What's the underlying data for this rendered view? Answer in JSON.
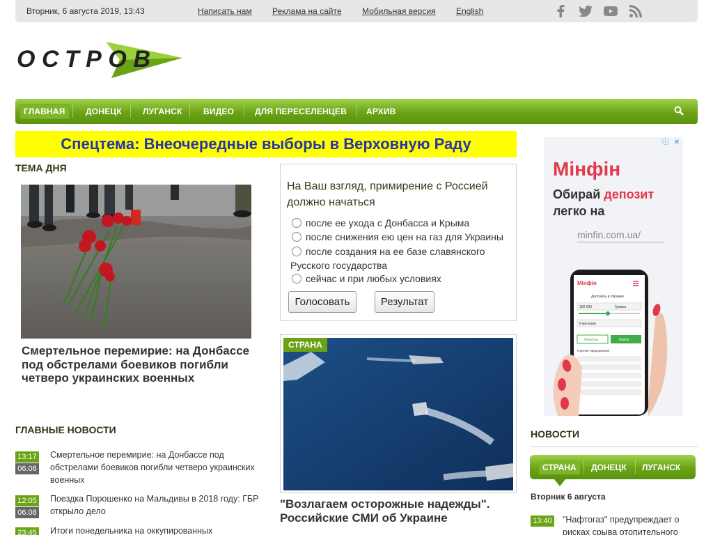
{
  "topbar": {
    "date": "Вторник, 6 августа 2019, 13:43",
    "links": [
      "Написать нам",
      "Реклама на сайте",
      "Мобильная версия",
      "English"
    ],
    "social_icons": [
      "facebook-icon",
      "twitter-icon",
      "youtube-icon",
      "rss-icon"
    ]
  },
  "logo": {
    "text": "ОСТРОВ"
  },
  "nav": {
    "items": [
      "ГЛАВНАЯ",
      "ДОНЕЦК",
      "ЛУГАНСК",
      "ВИДЕО",
      "ДЛЯ ПЕРЕСЕЛЕНЦЕВ",
      "АРХИВ"
    ],
    "active": "ГЛАВНАЯ"
  },
  "special": "Спецтема: Внеочередные выборы в Верховную Раду",
  "theme_day": {
    "title": "ТЕМА ДНЯ",
    "headline": "Смертельное перемирие: на Донбассе под обстрелами боевиков погибли четверо украинских военных"
  },
  "poll": {
    "question": "На Ваш взгляд, примирение с Россией должно начаться",
    "options": [
      "после ее ухода с Донбасса и Крыма",
      "после снижения ею цен на газ для Украины",
      "после создания на ее базе славянского",
      "сейчас и при любых условиях"
    ],
    "option3_cont": "Русского государства",
    "vote_label": "Голосовать",
    "result_label": "Результат"
  },
  "feature": {
    "tag": "СТРАНА",
    "headline": "\"Возлагаем осторожные надежды\". Российские СМИ об Украине"
  },
  "main_news": {
    "title": "ГЛАВНЫЕ НОВОСТИ",
    "items": [
      {
        "time": "13:17",
        "date": "06.08",
        "text": "Смертельное перемирие: на Донбассе под обстрелами боевиков погибли четверо украинских военных"
      },
      {
        "time": "12:05",
        "date": "06.08",
        "text": "Поездка Порошенко на Мальдивы в 2018 году: ГБР открыло дело"
      },
      {
        "time": "23:45",
        "date": "",
        "text": "Итоги понедельника на оккупированных"
      }
    ]
  },
  "ad": {
    "brand": "Мінфін",
    "slogan_1": "Обирай ",
    "slogan_red": "депозит",
    "slogan_2": " легко на",
    "url": "minfin.com.ua/",
    "phone_header": "Мінфін",
    "phone_title": "Депозиты в Украине",
    "phone_amount": "100 000",
    "phone_currency": "Гривна",
    "phone_term": "6 месяцев",
    "phone_btn1": "Фильтры",
    "phone_btn2": "Найти",
    "phone_list_title": "Горячие предложения"
  },
  "right_news": {
    "title": "НОВОСТИ",
    "tabs": [
      "СТРАНА",
      "ДОНЕЦК",
      "ЛУГАНСК"
    ],
    "active": "СТРАНА",
    "date": "Вторник 6 августа",
    "item_time": "13:40",
    "item_text": "\"Нафтогаз\" предупреждает о рисках срыва отопительного"
  }
}
